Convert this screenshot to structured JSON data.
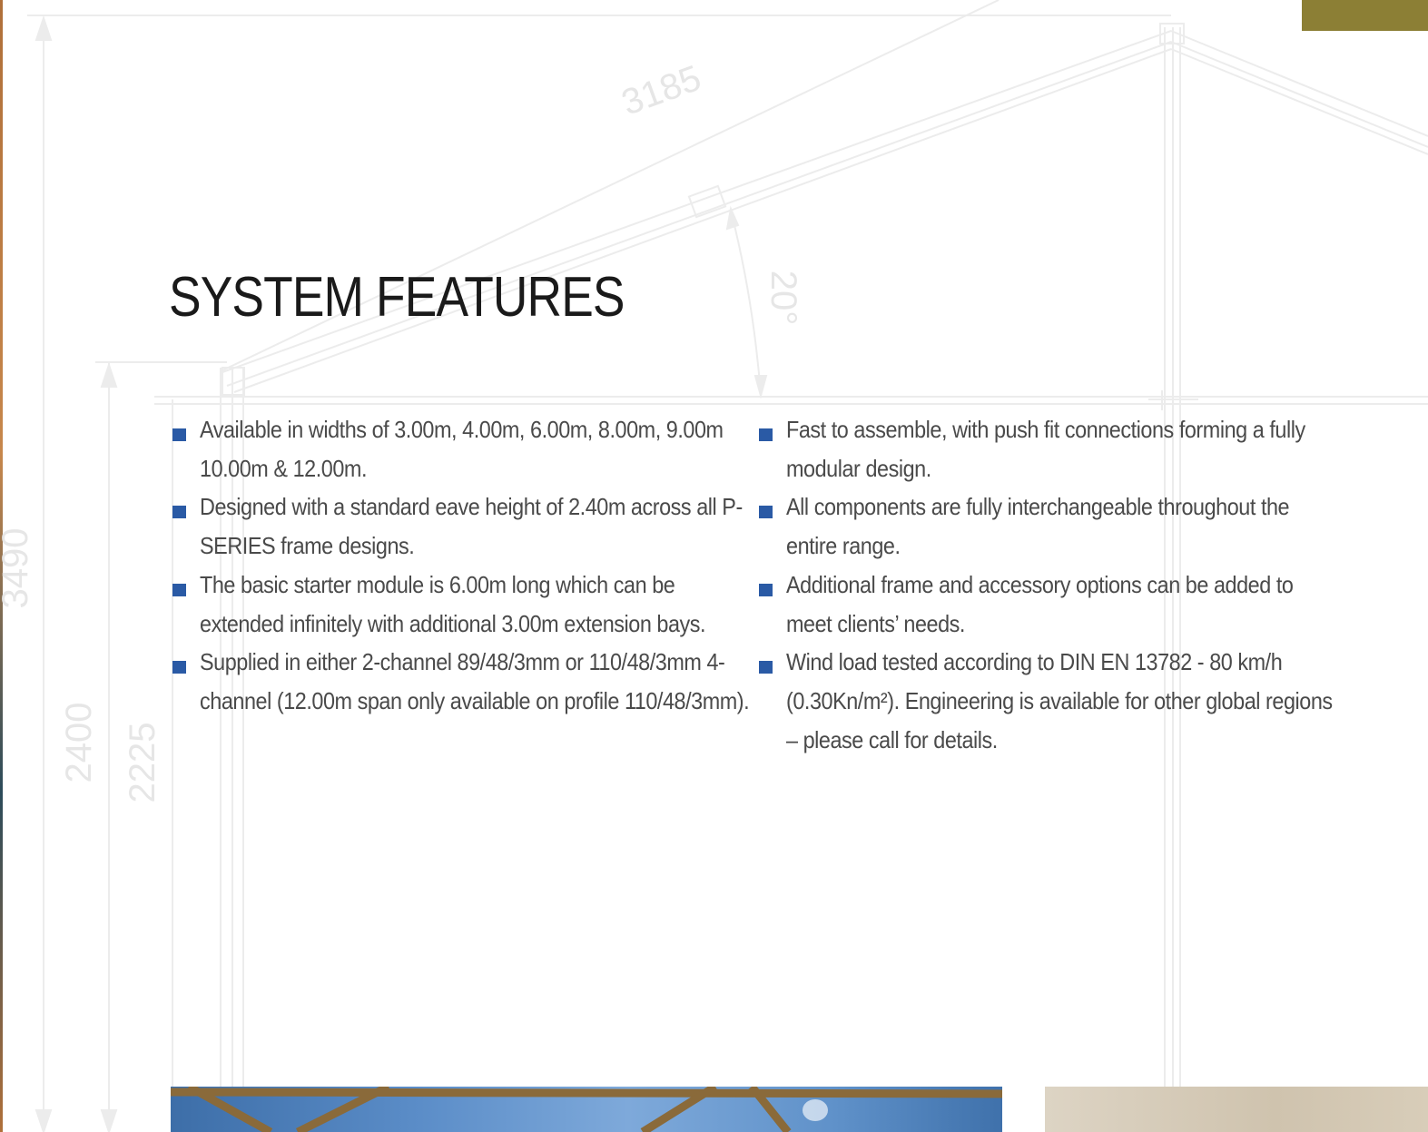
{
  "page": {
    "title": "SYSTEM FEATURES",
    "accent_color": "#8c7f35",
    "bullet_color": "#2a5aa5"
  },
  "blueprint": {
    "dimensions": [
      "3185",
      "20°",
      "3490",
      "2400",
      "2225"
    ]
  },
  "features": {
    "left": [
      "Available in widths of 3.00m, 4.00m, 6.00m, 8.00m, 9.00m 10.00m & 12.00m.",
      "Designed with a standard eave height of 2.40m across all P-SERIES frame designs.",
      "The basic starter module is 6.00m long which can be extended infinitely with additional 3.00m extension bays.",
      "Supplied in either 2-channel 89/48/3mm or 110/48/3mm 4-channel (12.00m span only available on profile 110/48/3mm)."
    ],
    "right": [
      "Fast to assemble, with push fit connections forming a fully modular design.",
      "All components are fully interchangeable throughout the entire range.",
      "Additional frame and accessory options can be added to meet clients’ needs.",
      "Wind load tested according to DIN EN 13782 - 80 km/h (0.30Kn/m²). Engineering is available for other global regions –  please call for details."
    ]
  }
}
